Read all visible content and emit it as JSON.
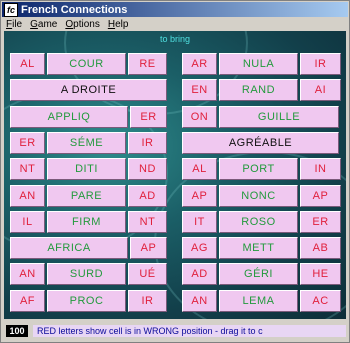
{
  "window": {
    "title": "French Connections",
    "icon_letter": "fc"
  },
  "menu": [
    {
      "label": "File",
      "u": "F",
      "rest": "ile"
    },
    {
      "label": "Game",
      "u": "G",
      "rest": "ame"
    },
    {
      "label": "Options",
      "u": "O",
      "rest": "ptions"
    },
    {
      "label": "Help",
      "u": "H",
      "rest": "elp"
    }
  ],
  "hint": "to bring",
  "colors": {
    "red": "#e0203c",
    "green": "#229a3c",
    "tile": "#f0c8f0"
  },
  "tiles": [
    {
      "text": "AL",
      "color": "red"
    },
    {
      "text": "COUR",
      "color": "green"
    },
    {
      "text": "RE",
      "color": "red"
    },
    {
      "text": "A DROITE",
      "color": "black"
    },
    {
      "text": "APPLIQ",
      "color": "green"
    },
    {
      "text": "ER",
      "color": "red"
    },
    {
      "text": "ER",
      "color": "red"
    },
    {
      "text": "SÉME",
      "color": "green"
    },
    {
      "text": "IR",
      "color": "red"
    },
    {
      "text": "NT",
      "color": "red"
    },
    {
      "text": "DITI",
      "color": "green"
    },
    {
      "text": "ND",
      "color": "red"
    },
    {
      "text": "AN",
      "color": "red"
    },
    {
      "text": "PARE",
      "color": "green"
    },
    {
      "text": "AD",
      "color": "red"
    },
    {
      "text": "IL",
      "color": "red"
    },
    {
      "text": "FIRM",
      "color": "green"
    },
    {
      "text": "NT",
      "color": "red"
    },
    {
      "text": "AFRICA",
      "color": "green"
    },
    {
      "text": "AP",
      "color": "red"
    },
    {
      "text": "AN",
      "color": "red"
    },
    {
      "text": "SURD",
      "color": "green"
    },
    {
      "text": "UÉ",
      "color": "red"
    },
    {
      "text": "AF",
      "color": "red"
    },
    {
      "text": "PROC",
      "color": "green"
    },
    {
      "text": "IR",
      "color": "red"
    },
    {
      "text": "AR",
      "color": "red"
    },
    {
      "text": "NULA",
      "color": "green"
    },
    {
      "text": "IR",
      "color": "red"
    },
    {
      "text": "EN",
      "color": "red"
    },
    {
      "text": "RAND",
      "color": "green"
    },
    {
      "text": "AI",
      "color": "red"
    },
    {
      "text": "ON",
      "color": "red"
    },
    {
      "text": "GUILLE",
      "color": "green"
    },
    {
      "text": "AGRÉABLE",
      "color": "black"
    },
    {
      "text": "AL",
      "color": "red"
    },
    {
      "text": "PORT",
      "color": "green"
    },
    {
      "text": "IN",
      "color": "red"
    },
    {
      "text": "AP",
      "color": "red"
    },
    {
      "text": "NONC",
      "color": "green"
    },
    {
      "text": "AP",
      "color": "red"
    },
    {
      "text": "IT",
      "color": "red"
    },
    {
      "text": "ROSO",
      "color": "green"
    },
    {
      "text": "ER",
      "color": "red"
    },
    {
      "text": "AG",
      "color": "red"
    },
    {
      "text": "METT",
      "color": "green"
    },
    {
      "text": "AB",
      "color": "red"
    },
    {
      "text": "AD",
      "color": "red"
    },
    {
      "text": "GÉRI",
      "color": "green"
    },
    {
      "text": "HE",
      "color": "red"
    },
    {
      "text": "AN",
      "color": "red"
    },
    {
      "text": "LEMA",
      "color": "green"
    },
    {
      "text": "AC",
      "color": "red"
    }
  ],
  "status": {
    "score": "100",
    "message": "RED letters show cell is in WRONG position - drag it to c"
  }
}
